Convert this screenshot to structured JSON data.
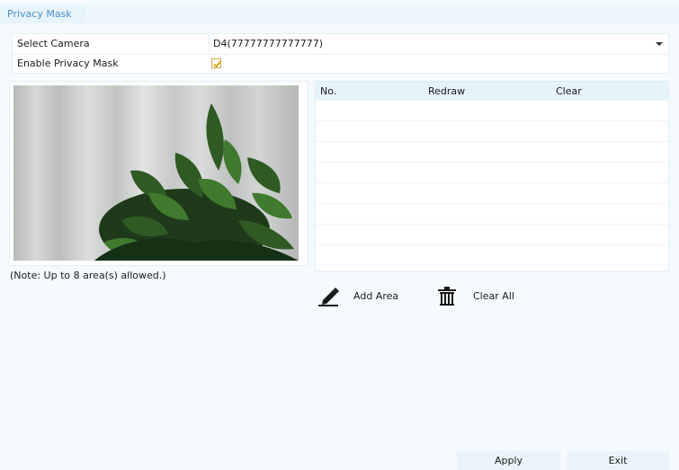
{
  "tab": {
    "title": "Privacy Mask"
  },
  "form": {
    "select_camera_label": "Select Camera",
    "select_camera_value": "D4(77777777777777)",
    "enable_label": "Enable Privacy Mask",
    "enable_checked": true
  },
  "table": {
    "headers": {
      "no": "No.",
      "redraw": "Redraw",
      "clear": "Clear"
    },
    "rows": []
  },
  "note": "(Note: Up to 8 area(s) allowed.)",
  "actions": {
    "add_area": "Add Area",
    "clear_all": "Clear All"
  },
  "buttons": {
    "apply": "Apply",
    "exit": "Exit"
  },
  "colors": {
    "accent": "#4a8fc8",
    "checkbox": "#e0a800",
    "background": "#f4fafd"
  }
}
